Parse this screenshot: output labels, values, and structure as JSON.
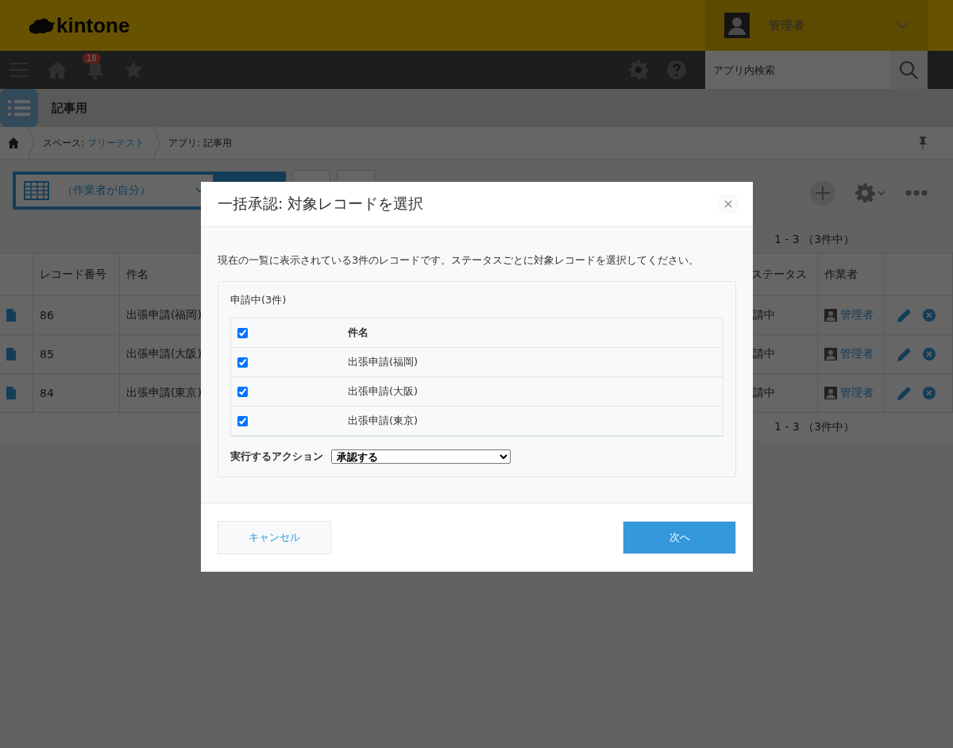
{
  "header": {
    "logo": "kintone",
    "user": "管理者"
  },
  "nav": {
    "notification_count": "18",
    "search": {
      "placeholder": "アプリ内検索"
    }
  },
  "app": {
    "title": "記事用"
  },
  "breadcrumb": [
    {
      "label": "スペース:",
      "link": "フリーテスト"
    },
    {
      "label": "アプリ: 記事用"
    }
  ],
  "view_select": {
    "value": "（作業者が自分）"
  },
  "pager_top": "1 - 3 （3件中）",
  "table": {
    "columns": [
      "レコード番号",
      "件名",
      "ステータス",
      "作業者"
    ],
    "rows": [
      {
        "number": "86",
        "title": "出張申請(福岡)",
        "status": "請中",
        "assignee": "管理者"
      },
      {
        "number": "85",
        "title": "出張申請(大阪)",
        "status": "請中",
        "assignee": "管理者"
      },
      {
        "number": "84",
        "title": "出張申請(東京)",
        "status": "請中",
        "assignee": "管理者"
      }
    ]
  },
  "pager_bottom": "1 - 3 （3件中）",
  "dialog": {
    "title": "一括承認: 対象レコードを選択",
    "description": "現在の一覧に表示されている3件のレコードです。ステータスごとに対象レコードを選択してください。",
    "group": {
      "title": "申請中(3件)",
      "header": {
        "checked": true,
        "label": "件名"
      },
      "rows": [
        {
          "checked": true,
          "label": "出張申請(福岡)"
        },
        {
          "checked": true,
          "label": "出張申請(大阪)"
        },
        {
          "checked": true,
          "label": "出張申請(東京)"
        }
      ]
    },
    "action": {
      "label": "実行するアクション",
      "value": "承認する"
    },
    "buttons": [
      {
        "kind": "secondary",
        "label": "キャンセル"
      },
      {
        "kind": "primary",
        "label": "次へ"
      }
    ]
  }
}
